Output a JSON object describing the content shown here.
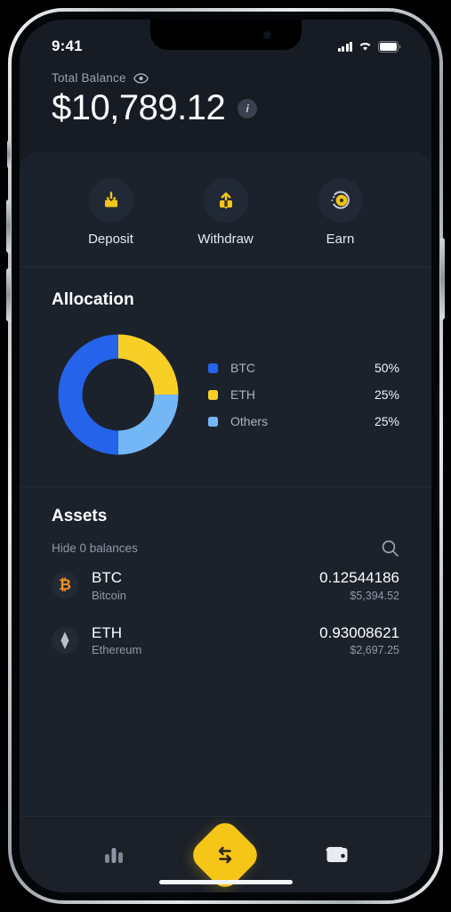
{
  "status_bar": {
    "time": "9:41",
    "cellular_icon": "cellular-bars-icon",
    "wifi_icon": "wifi-icon",
    "battery_icon": "battery-icon"
  },
  "hero": {
    "label": "Total Balance",
    "eye_icon": "eye-visible-icon",
    "value": "$10,789.12",
    "info_icon": "info-icon"
  },
  "quick_actions": [
    {
      "label": "Deposit",
      "icon": "deposit-arrow-down-icon"
    },
    {
      "label": "Withdraw",
      "icon": "withdraw-arrow-up-icon"
    },
    {
      "label": "Earn",
      "icon": "earn-coin-icon"
    }
  ],
  "allocation": {
    "title": "Allocation"
  },
  "chart_data": {
    "type": "pie",
    "title": "Allocation",
    "categories": [
      "BTC",
      "ETH",
      "Others"
    ],
    "values": [
      50,
      25,
      25
    ],
    "labels": [
      "50%",
      "25%",
      "25%"
    ],
    "colors": [
      "#2563eb",
      "#f8cf26",
      "#74b7f7"
    ],
    "legend_position": "right",
    "donut": true,
    "unit": "%"
  },
  "assets": {
    "title": "Assets",
    "hide_balances_label": "Hide 0 balances",
    "search_icon": "search-icon",
    "rows": [
      {
        "symbol": "BTC",
        "name": "Bitcoin",
        "amount": "0.12544186",
        "fiat": "$5,394.52",
        "icon": "bitcoin-icon",
        "icon_glyph": "₿",
        "icon_color": "#f7931a"
      },
      {
        "symbol": "ETH",
        "name": "Ethereum",
        "amount": "0.93008621",
        "fiat": "$2,697.25",
        "icon": "ethereum-icon",
        "icon_glyph": "⧫",
        "icon_color": "#b9c0cc"
      }
    ]
  },
  "bottom_nav": [
    {
      "name": "markets-tab",
      "icon": "bar-chart-icon"
    },
    {
      "name": "swap-tab",
      "icon": "swap-arrows-icon"
    },
    {
      "name": "wallet-tab",
      "icon": "wallet-icon"
    }
  ],
  "colors": {
    "accent_yellow": "#f5c518",
    "btc_blue": "#2563eb",
    "eth_yellow": "#f8cf26",
    "others_blue": "#74b7f7",
    "screen_bg": "#161b24",
    "sheet_bg": "#1c222c"
  }
}
